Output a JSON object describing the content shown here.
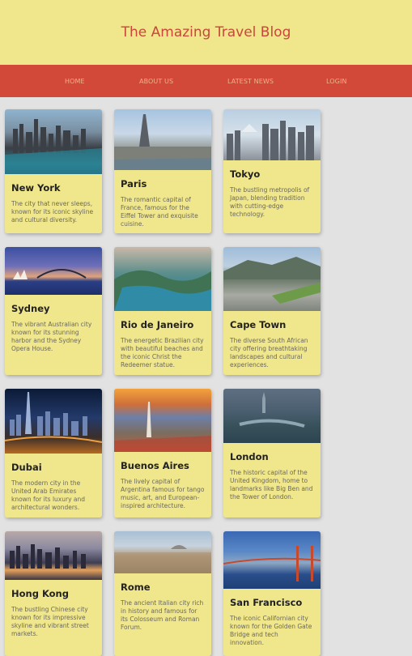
{
  "header": {
    "title": "The Amazing Travel Blog"
  },
  "nav": {
    "items": [
      "HOME",
      "ABOUT US",
      "LATEST NEWS",
      "LOGIN"
    ]
  },
  "cards": [
    {
      "name": "New York",
      "desc": "The city that never sleeps, known for its iconic skyline and cultural diversity."
    },
    {
      "name": "Paris",
      "desc": "The romantic capital of France, famous for the Eiffel Tower and exquisite cuisine."
    },
    {
      "name": "Tokyo",
      "desc": "The bustling metropolis of Japan, blending tradition with cutting-edge technology."
    },
    {
      "name": "Sydney",
      "desc": "The vibrant Australian city known for its stunning harbor and the Sydney Opera House."
    },
    {
      "name": "Rio de Janeiro",
      "desc": "The energetic Brazilian city with beautiful beaches and the iconic Christ the Redeemer statue."
    },
    {
      "name": "Cape Town",
      "desc": "The diverse South African city offering breathtaking landscapes and cultural experiences."
    },
    {
      "name": "Dubai",
      "desc": "The modern city in the United Arab Emirates known for its luxury and architectural wonders."
    },
    {
      "name": "Buenos Aires",
      "desc": "The lively capital of Argentina famous for tango music, art, and European-inspired architecture."
    },
    {
      "name": "London",
      "desc": "The historic capital of the United Kingdom, home to landmarks like Big Ben and the Tower of London."
    },
    {
      "name": "Hong Kong",
      "desc": "The bustling Chinese city known for its impressive skyline and vibrant street markets."
    },
    {
      "name": "Rome",
      "desc": "The ancient Italian city rich in history and famous for its Colosseum and Roman Forum."
    },
    {
      "name": "San Francisco",
      "desc": "The iconic Californian city known for the Golden Gate Bridge and tech innovation."
    }
  ]
}
